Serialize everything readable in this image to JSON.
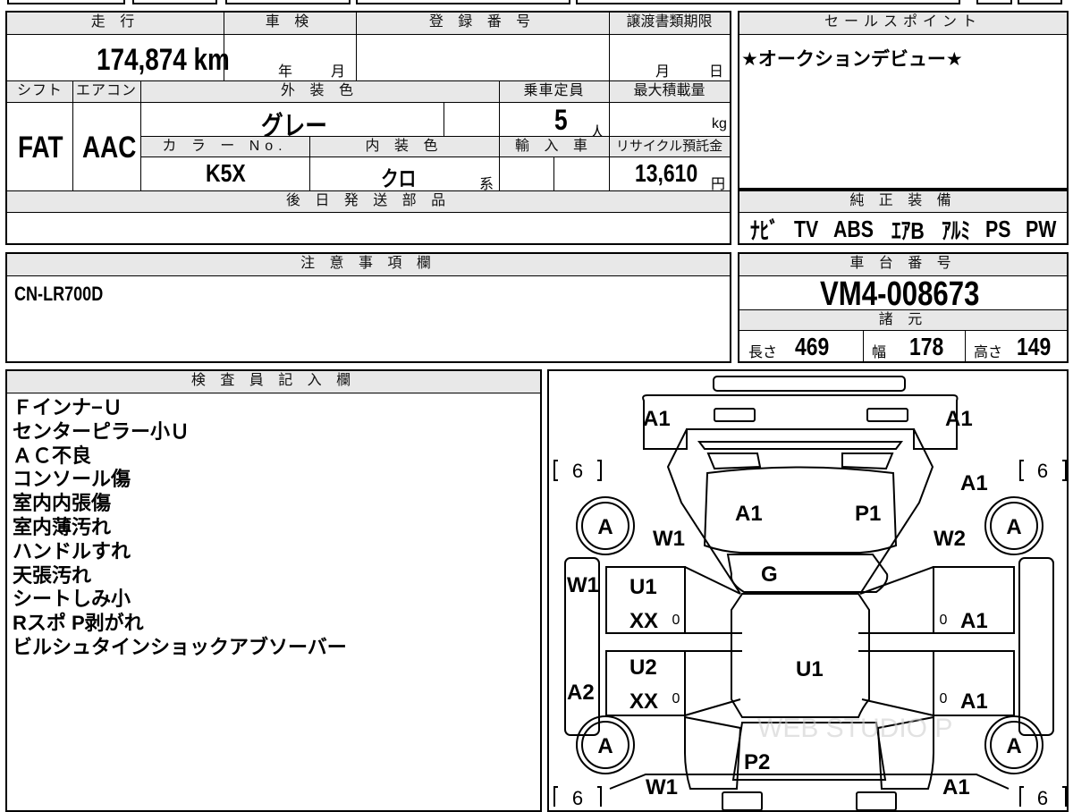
{
  "top_strip": {
    "fragment_a": "",
    "fragment_b": "."
  },
  "mileage": {
    "header": "走 行",
    "value": "174,874 km"
  },
  "inspection": {
    "header": "車 検",
    "year_unit": "年",
    "month_unit": "月"
  },
  "registration": {
    "header": "登 録 番 号",
    "value": ""
  },
  "transfer_deadline": {
    "header": "譲渡書類期限",
    "month_unit": "月",
    "day_unit": "日"
  },
  "sales_point": {
    "header": "セールスポイント",
    "text": "★オークションデビュー★"
  },
  "shift": {
    "header": "シフト",
    "value": "FAT"
  },
  "aircon": {
    "header": "エアコン",
    "value": "AAC"
  },
  "exterior_color": {
    "header": "外 装 色",
    "value": "グレー"
  },
  "capacity": {
    "header": "乗車定員",
    "value": "5",
    "unit": "人"
  },
  "max_load": {
    "header": "最大積載量",
    "unit": "kg"
  },
  "color_no": {
    "header": "カ ラ ー No.",
    "value": "K5X"
  },
  "interior_color": {
    "header": "内 装 色",
    "value": "クロ",
    "suffix": "系"
  },
  "import_car": {
    "header": "輸 入 車"
  },
  "recycle_fee": {
    "header": "リサイクル預託金",
    "value": "13,610",
    "unit": "円"
  },
  "later_parts": {
    "header": "後 日 発 送 部 品",
    "value": ""
  },
  "genuine_equipment": {
    "header": "純 正 装 備",
    "items": [
      "ﾅﾋﾞ",
      "TV",
      "ABS",
      "ｴｱB",
      "ｱﾙﾐ",
      "PS",
      "PW"
    ]
  },
  "caution": {
    "header": "注 意 事 項 欄",
    "text": "CN-LR700D"
  },
  "chassis": {
    "header": "車 台 番 号",
    "value": "VM4-008673"
  },
  "specs": {
    "header": "諸 元",
    "length_label": "長さ",
    "length": "469",
    "width_label": "幅",
    "width": "178",
    "height_label": "高さ",
    "height": "149"
  },
  "inspector": {
    "header": "検 査 員 記 入 欄",
    "lines": [
      "Ｆインナ−Ｕ",
      "センターピラー小Ｕ",
      "ＡＣ不良",
      "コンソール傷",
      "室内内張傷",
      "室内薄汚れ",
      "ハンドルすれ",
      "天張汚れ",
      "シートしみ小",
      "Rスポ P剥がれ",
      "ビルシュタインショックアブソーバー"
    ]
  },
  "diagram": {
    "labels": {
      "front_left": "A1",
      "front_right": "A1",
      "hood_left": "A1",
      "hood_right": "P1",
      "fender_fl": "W1",
      "fender_fr": "W2",
      "fender_fr_top": "A1",
      "windshield": "G",
      "side_left": "W1",
      "door_fl_top": "U1",
      "door_fl_bottom": "XX",
      "door_fr": "A1",
      "roof": "U1",
      "door_rl_top": "U2",
      "door_rl_bottom": "XX",
      "door_rr": "A1",
      "side_left_rear": "A2",
      "trunk": "P2",
      "rear_left": "W1",
      "rear_right": "A1",
      "tire": "A",
      "tire_size": "6",
      "zero": "0",
      "watermark": "WEB STUDIO P"
    }
  }
}
